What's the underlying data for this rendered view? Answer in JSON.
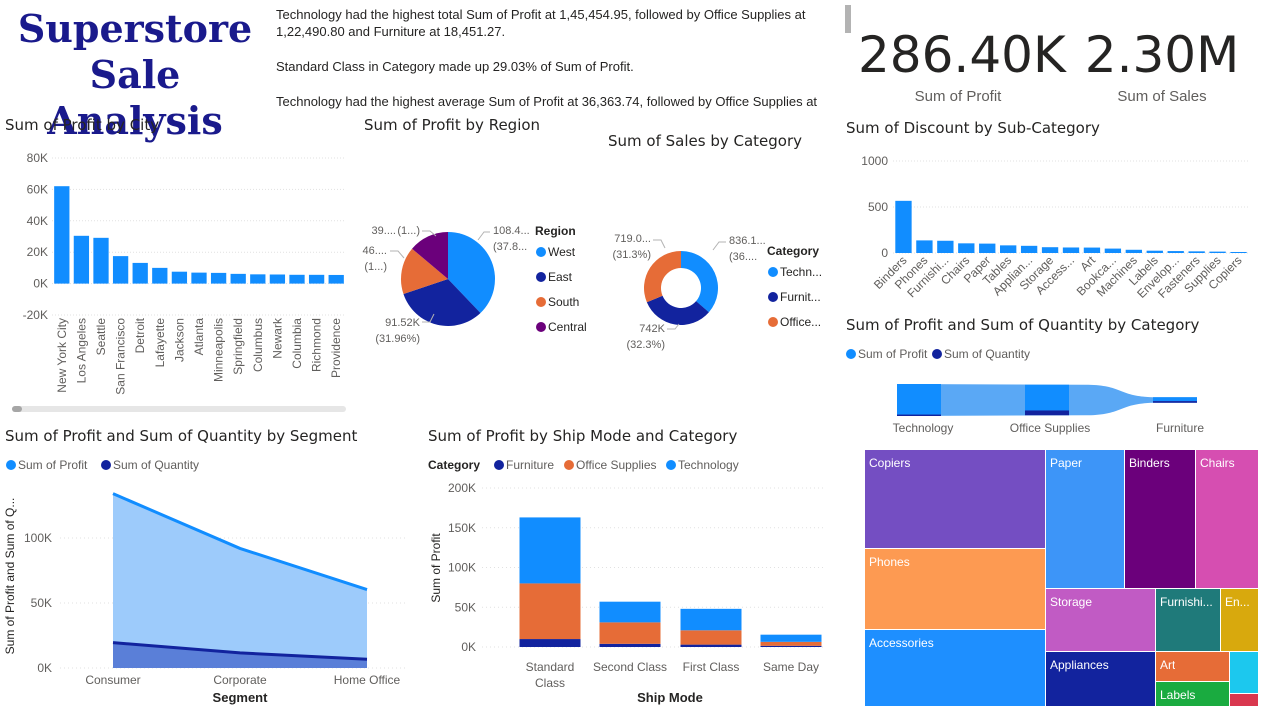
{
  "header": {
    "title_line1": "Superstore",
    "title_line2": "Sale Analysis",
    "insights": [
      "Technology had the highest total Sum of Profit at 1,45,454.95, followed by Office Supplies at 1,22,490.80 and Furniture at 18,451.27.",
      "Standard Class in Category  made up 29.03% of Sum of Profit.",
      "Technology had the highest average Sum of Profit at 36,363.74, followed by Office Supplies at"
    ]
  },
  "kpis": [
    {
      "value": "286.40K",
      "label": "Sum of Profit"
    },
    {
      "value": "2.30M",
      "label": "Sum of Sales"
    }
  ],
  "visual_titles": {
    "city": "Sum of Profit by City",
    "region": "Sum of Profit by Region",
    "category_sales": "Sum of Sales by Category",
    "discount": "Sum of Discount by Sub-Category",
    "profit_qty_category": "Sum of Profit and Sum of Quantity by Category",
    "segment": "Sum of Profit and Sum of Quantity by Segment",
    "shipmode": "Sum of Profit by Ship Mode and Category"
  },
  "colors": {
    "blue": "#118dff",
    "navy": "#12239e",
    "orange": "#e66c37",
    "purple": "#6b007b",
    "grid": "#e1e1e1",
    "axis_text": "#605e5c"
  },
  "chart_data": [
    {
      "id": "city",
      "type": "bar",
      "title": "Sum of Profit by City",
      "categories": [
        "New York City",
        "Los Angeles",
        "Seattle",
        "San Francisco",
        "Detroit",
        "Lafayette",
        "Jackson",
        "Atlanta",
        "Minneapolis",
        "Springfield",
        "Columbus",
        "Newark",
        "Columbia",
        "Richmond",
        "Providence"
      ],
      "values": [
        62037,
        30441,
        29156,
        17507,
        13181,
        10018,
        7581,
        6994,
        6824,
        6200,
        5898,
        5794,
        5606,
        5587,
        5506
      ],
      "yticks": [
        "80K",
        "60K",
        "40K",
        "20K",
        "0K",
        "-20K"
      ],
      "ylim": [
        -20000,
        80000
      ],
      "grid": true
    },
    {
      "id": "region",
      "type": "pie",
      "title": "Sum of Profit by Region",
      "legend_title": "Region",
      "slices": [
        {
          "name": "West",
          "value": 108418,
          "label": "108.4...",
          "pct_label": "(37.8...",
          "color": "#118dff"
        },
        {
          "name": "East",
          "value": 91523,
          "label": "91.52K",
          "pct_label": "(31.96%)",
          "color": "#12239e"
        },
        {
          "name": "South",
          "value": 46749,
          "label": "46....",
          "pct_label": "(1...)",
          "color": "#e66c37"
        },
        {
          "name": "Central",
          "value": 39706,
          "label": "39....",
          "pct_label": "(1...)",
          "color": "#6b007b"
        }
      ]
    },
    {
      "id": "category_sales",
      "type": "pie",
      "title": "Sum of Sales by Category",
      "legend_title": "Category",
      "slices": [
        {
          "name": "Techn...",
          "value": 836154,
          "label": "836.1...",
          "pct_label": "(36....",
          "color": "#118dff"
        },
        {
          "name": "Furnit...",
          "value": 741999,
          "label": "742K",
          "pct_label": "(32.3%)",
          "color": "#12239e"
        },
        {
          "name": "Office...",
          "value": 719047,
          "label": "719.0...",
          "pct_label": "(31.3%)",
          "color": "#e66c37"
        }
      ]
    },
    {
      "id": "discount",
      "type": "bar",
      "title": "Sum of Discount by Sub-Category",
      "categories": [
        "Binders",
        "Phones",
        "Furnishi...",
        "Chairs",
        "Paper",
        "Tables",
        "Applian...",
        "Storage",
        "Access...",
        "Art",
        "Bookca...",
        "Machines",
        "Labels",
        "Envelop...",
        "Fasteners",
        "Supplies",
        "Copiers"
      ],
      "values": [
        567,
        137,
        133,
        105,
        102,
        83,
        78,
        63,
        60,
        59,
        48,
        35,
        25,
        21,
        18,
        15,
        11
      ],
      "yticks": [
        "1000",
        "500",
        "0"
      ],
      "ylim": [
        0,
        1000
      ],
      "grid": true
    },
    {
      "id": "profit_qty_category",
      "type": "area",
      "title": "Sum of Profit and Sum of Quantity by Category",
      "categories": [
        "Technology",
        "Office Supplies",
        "Furniture"
      ],
      "series": [
        {
          "name": "Sum of Profit",
          "values": [
            145455,
            122491,
            18451
          ]
        },
        {
          "name": "Sum of Quantity",
          "values": [
            6939,
            22906,
            8028
          ]
        }
      ]
    },
    {
      "id": "segment",
      "type": "area",
      "title": "Sum of Profit and Sum of Quantity by Segment",
      "xlabel": "Segment",
      "ylabel": "Sum of Profit and Sum of Q...",
      "categories": [
        "Consumer",
        "Corporate",
        "Home Office"
      ],
      "yticks": [
        "100K",
        "50K",
        "0K"
      ],
      "ylim": [
        0,
        140000
      ],
      "series": [
        {
          "name": "Sum of Profit",
          "values": [
            134119,
            91979,
            60299
          ]
        },
        {
          "name": "Sum of Quantity",
          "values": [
            19521,
            11608,
            6744
          ]
        }
      ]
    },
    {
      "id": "shipmode",
      "type": "bar",
      "stacked": true,
      "title": "Sum of Profit by Ship Mode and Category",
      "legend_title": "Category",
      "xlabel": "Ship Mode",
      "ylabel": "Sum of Profit",
      "categories": [
        "Standard Class",
        "Second Class",
        "First Class",
        "Same Day"
      ],
      "yticks": [
        "200K",
        "150K",
        "100K",
        "50K",
        "0K"
      ],
      "ylim": [
        0,
        200000
      ],
      "series": [
        {
          "name": "Furniture",
          "values": [
            10000,
            4000,
            3000,
            1500
          ]
        },
        {
          "name": "Office Supplies",
          "values": [
            70000,
            27000,
            18000,
            5000
          ]
        },
        {
          "name": "Technology",
          "values": [
            83000,
            26000,
            27000,
            9000
          ]
        }
      ]
    },
    {
      "id": "treemap",
      "type": "treemap",
      "cells": [
        {
          "name": "Copiers",
          "color": "#744ec2"
        },
        {
          "name": "Phones",
          "color": "#fd9a52"
        },
        {
          "name": "Accessories",
          "color": "#1e8fff"
        },
        {
          "name": "Paper",
          "color": "#3d95f8"
        },
        {
          "name": "Binders",
          "color": "#6b007b"
        },
        {
          "name": "Chairs",
          "color": "#d64eb1"
        },
        {
          "name": "Storage",
          "color": "#c15bc4"
        },
        {
          "name": "Furnishi...",
          "color": "#1f7a7a"
        },
        {
          "name": "En...",
          "color": "#d8a90d"
        },
        {
          "name": "Appliances",
          "color": "#12239e"
        },
        {
          "name": "Art",
          "color": "#e66c37"
        },
        {
          "name": "Labels",
          "color": "#1aab40"
        },
        {
          "name": "",
          "color": "#1cc8ee"
        },
        {
          "name": "",
          "color": "#d9384f"
        }
      ]
    }
  ]
}
